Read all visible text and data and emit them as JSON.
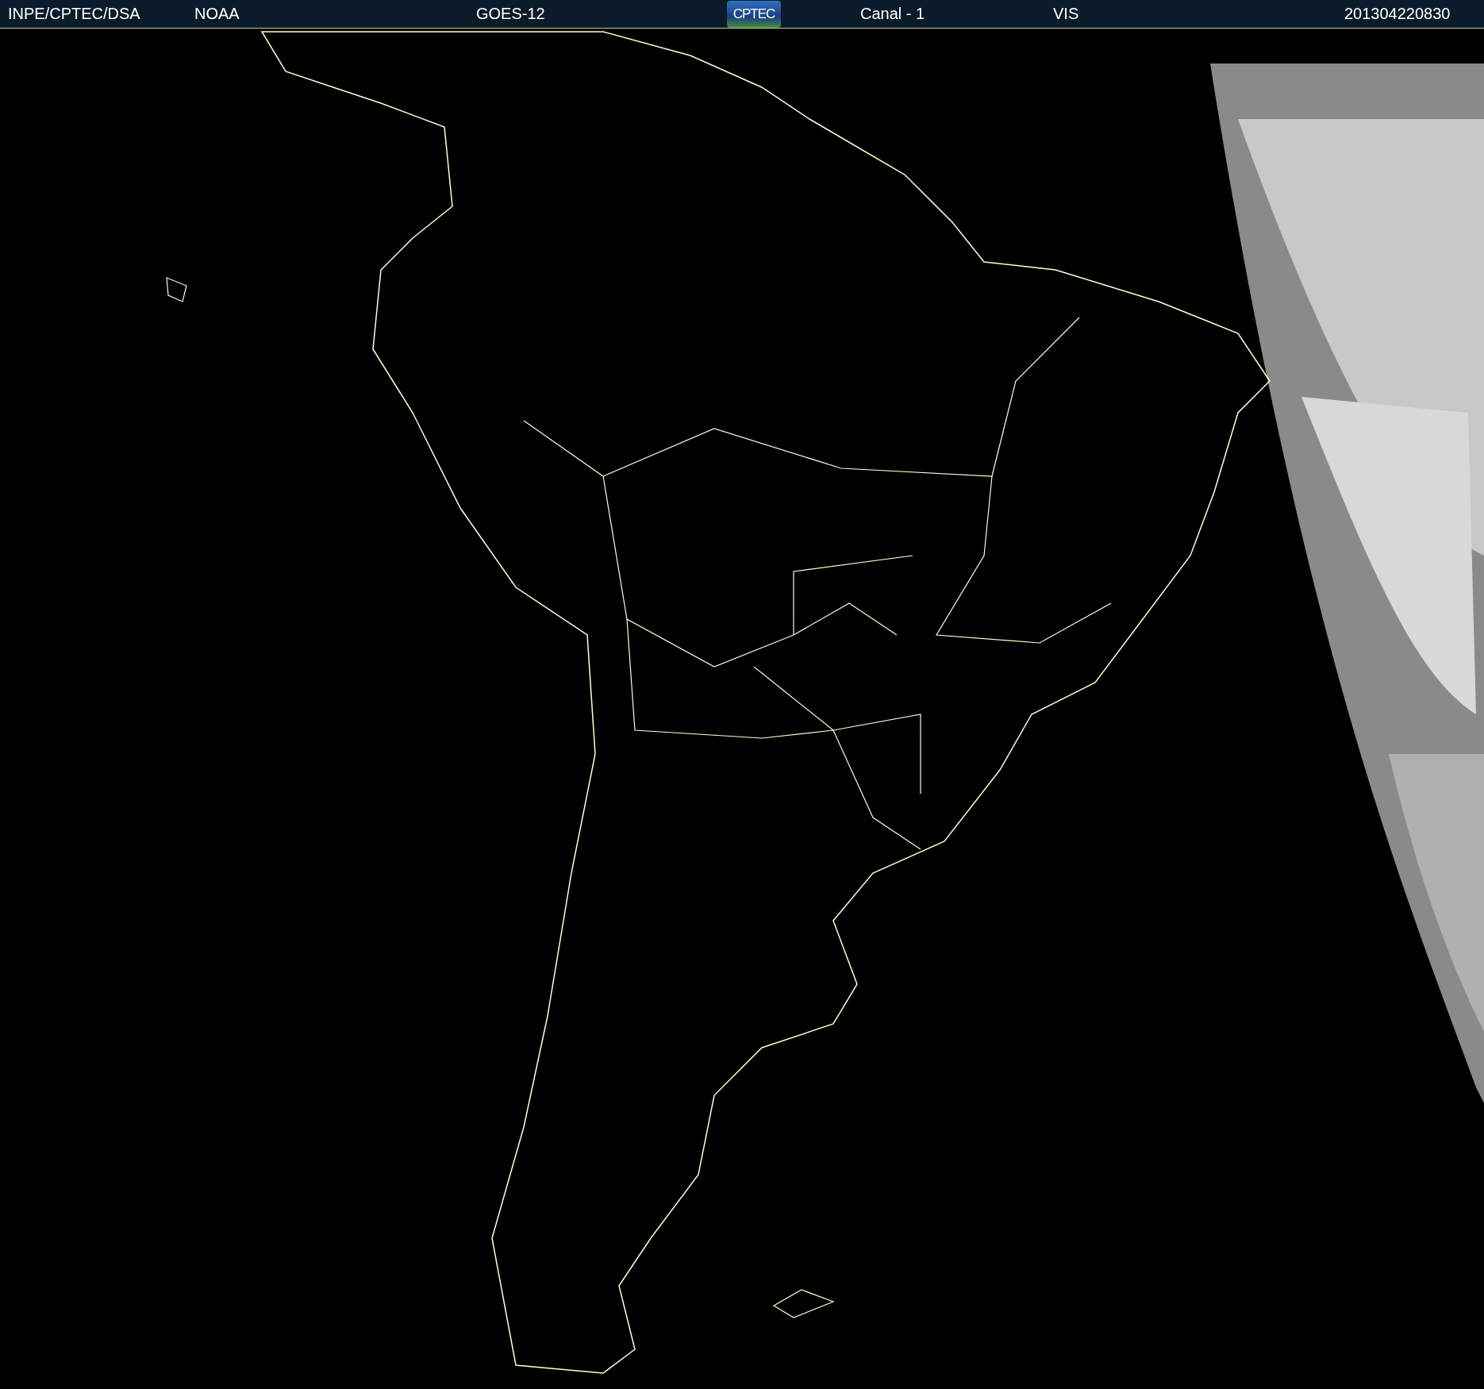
{
  "header": {
    "source": "INPE/CPTEC/DSA",
    "agency": "NOAA",
    "satellite": "GOES-12",
    "logo": "CPTEC",
    "channel": "Canal - 1",
    "band": "VIS",
    "timestamp": "201304220830"
  }
}
